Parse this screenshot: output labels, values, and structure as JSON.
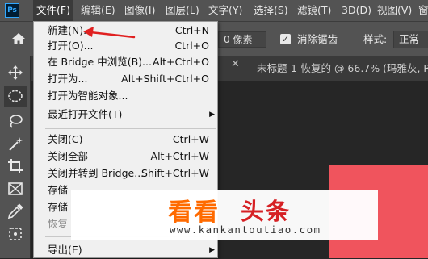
{
  "app": {
    "logo_text": "Ps"
  },
  "menubar": {
    "items": [
      {
        "label": "文件(F)"
      },
      {
        "label": "编辑(E)"
      },
      {
        "label": "图像(I)"
      },
      {
        "label": "图层(L)"
      },
      {
        "label": "文字(Y)"
      },
      {
        "label": "选择(S)"
      },
      {
        "label": "滤镜(T)"
      },
      {
        "label": "3D(D)"
      },
      {
        "label": "视图(V)"
      },
      {
        "label": "窗"
      }
    ]
  },
  "options_bar": {
    "feather_value": "0 像素",
    "antialias_label": "消除锯齿",
    "antialias_checked": true,
    "style_label": "样式:",
    "style_value": "正常"
  },
  "document": {
    "tab_title": "未标题-1-恢复的 @ 66.7% (玛雅灰, R"
  },
  "file_menu": {
    "items": [
      {
        "label": "新建(N)...",
        "shortcut": "Ctrl+N",
        "enabled": true
      },
      {
        "label": "打开(O)...",
        "shortcut": "Ctrl+O",
        "enabled": true
      },
      {
        "label": "在 Bridge 中浏览(B)...",
        "shortcut": "Alt+Ctrl+O",
        "enabled": true
      },
      {
        "label": "打开为...",
        "shortcut": "Alt+Shift+Ctrl+O",
        "enabled": true
      },
      {
        "label": "打开为智能对象...",
        "shortcut": "",
        "enabled": true
      },
      {
        "label": "最近打开文件(T)",
        "shortcut": "",
        "enabled": true,
        "submenu": true
      },
      {
        "label": "关闭(C)",
        "shortcut": "Ctrl+W",
        "enabled": true
      },
      {
        "label": "关闭全部",
        "shortcut": "Alt+Ctrl+W",
        "enabled": true
      },
      {
        "label": "关闭并转到 Bridge...",
        "shortcut": "Shift+Ctrl+W",
        "enabled": true
      },
      {
        "label": "存储",
        "shortcut": "",
        "enabled": true
      },
      {
        "label": "存储",
        "shortcut": "",
        "enabled": true
      },
      {
        "label": "恢复",
        "shortcut": "",
        "enabled": false
      },
      {
        "label": "导出(E)",
        "shortcut": "",
        "enabled": true,
        "submenu": true
      }
    ]
  },
  "watermark": {
    "brand_part1": "看看",
    "brand_part2": "头条",
    "url": "www.kankantoutiao.com"
  },
  "colors": {
    "annotation_arrow": "#e02020",
    "canvas_fill": "#f0545d"
  }
}
